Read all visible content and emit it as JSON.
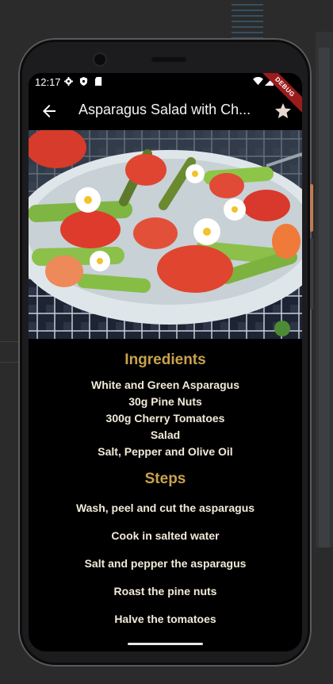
{
  "status_bar": {
    "time": "12:17",
    "debug_banner": "DEBUG"
  },
  "app_bar": {
    "title": "Asparagus Salad with Ch..."
  },
  "ingredients": {
    "heading": "Ingredients",
    "items": [
      "White and Green Asparagus",
      "30g Pine Nuts",
      "300g Cherry Tomatoes",
      "Salad",
      "Salt, Pepper and Olive Oil"
    ]
  },
  "steps": {
    "heading": "Steps",
    "items": [
      "Wash, peel and cut the asparagus",
      "Cook in salted water",
      "Salt and pepper the asparagus",
      "Roast the pine nuts",
      "Halve the tomatoes"
    ]
  },
  "colors": {
    "accent": "#c9a24d",
    "text": "#f2ead9",
    "background": "#000000"
  }
}
